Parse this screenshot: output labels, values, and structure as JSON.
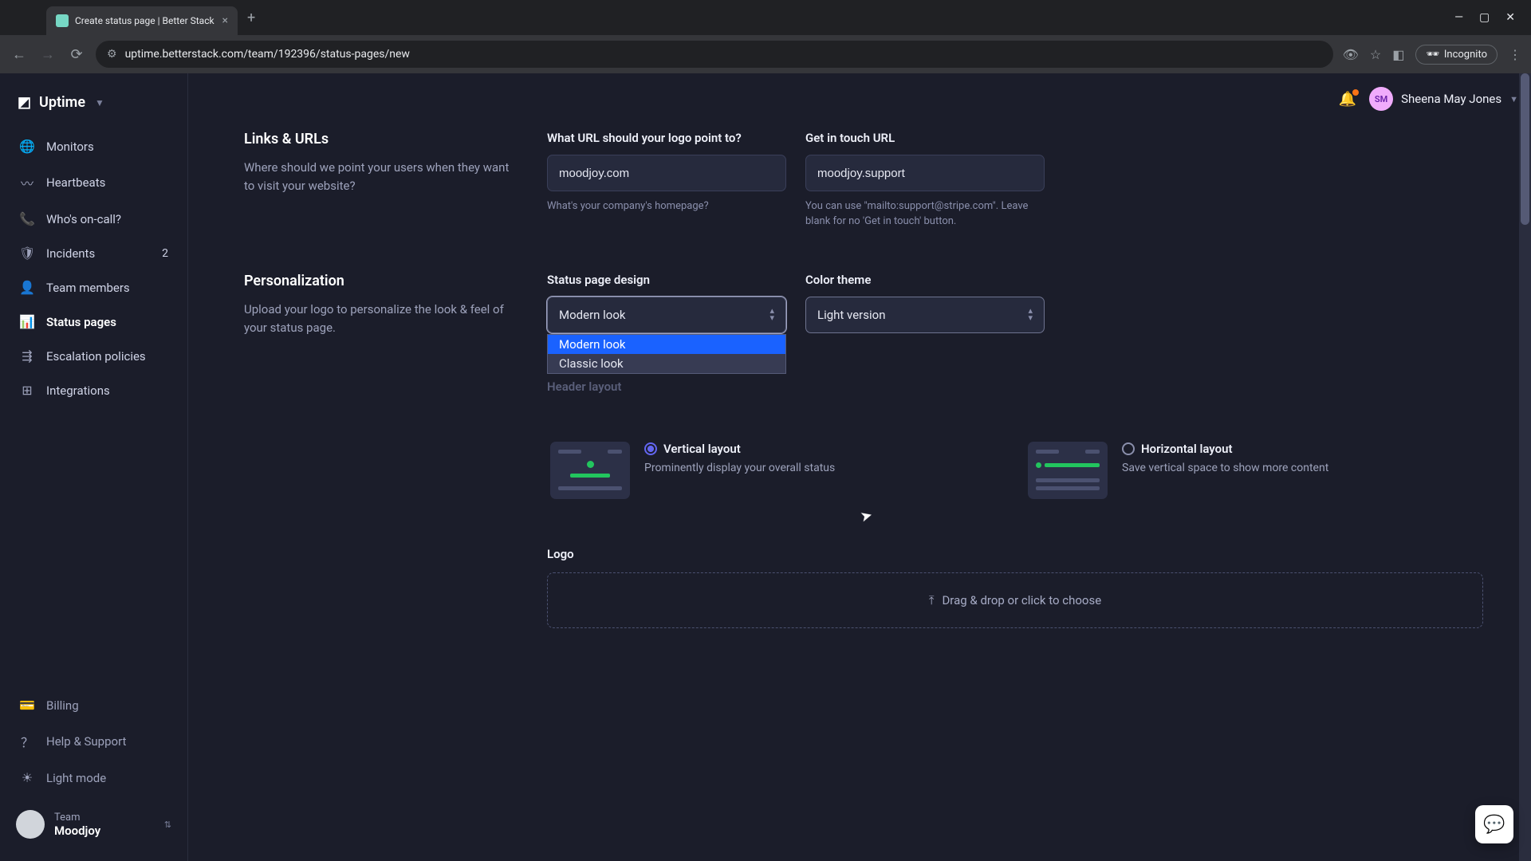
{
  "browser": {
    "tab_title": "Create status page | Better Stack",
    "url": "uptime.betterstack.com/team/192396/status-pages/new",
    "incognito_label": "Incognito"
  },
  "brand": {
    "name": "Uptime"
  },
  "sidebar": {
    "items": [
      {
        "icon": "🌐",
        "label": "Monitors"
      },
      {
        "icon": "〰",
        "label": "Heartbeats"
      },
      {
        "icon": "📞",
        "label": "Who's on-call?"
      },
      {
        "icon": "🛡",
        "label": "Incidents",
        "badge": "2"
      },
      {
        "icon": "👤",
        "label": "Team members"
      },
      {
        "icon": "📊",
        "label": "Status pages"
      },
      {
        "icon": "⇶",
        "label": "Escalation policies"
      },
      {
        "icon": "⊞",
        "label": "Integrations"
      }
    ],
    "footer": [
      {
        "icon": "💳",
        "label": "Billing"
      },
      {
        "icon": "？",
        "label": "Help & Support"
      },
      {
        "icon": "☀",
        "label": "Light mode"
      }
    ],
    "team": {
      "label": "Team",
      "name": "Moodjoy"
    }
  },
  "user": {
    "initials": "SM",
    "name": "Sheena May Jones"
  },
  "links_section": {
    "title": "Links & URLs",
    "desc": "Where should we point your users when they want to visit your website?",
    "logo_url_label": "What URL should your logo point to?",
    "logo_url_value": "moodjoy.com",
    "logo_url_helper": "What's your company's homepage?",
    "contact_label": "Get in touch URL",
    "contact_value": "moodjoy.support",
    "contact_helper": "You can use \"mailto:support@stripe.com\". Leave blank for no 'Get in touch' button."
  },
  "personalization": {
    "title": "Personalization",
    "desc": "Upload your logo to personalize the look & feel of your status page.",
    "design_label": "Status page design",
    "design_value": "Modern look",
    "design_options": [
      "Modern look",
      "Classic look"
    ],
    "theme_label": "Color theme",
    "theme_value": "Light version",
    "header_layout_label": "Header layout",
    "vertical": {
      "title": "Vertical layout",
      "desc": "Prominently display your overall status"
    },
    "horizontal": {
      "title": "Horizontal layout",
      "desc": "Save vertical space to show more content"
    },
    "logo_label": "Logo",
    "dropzone_text": "Drag & drop or click to choose"
  }
}
